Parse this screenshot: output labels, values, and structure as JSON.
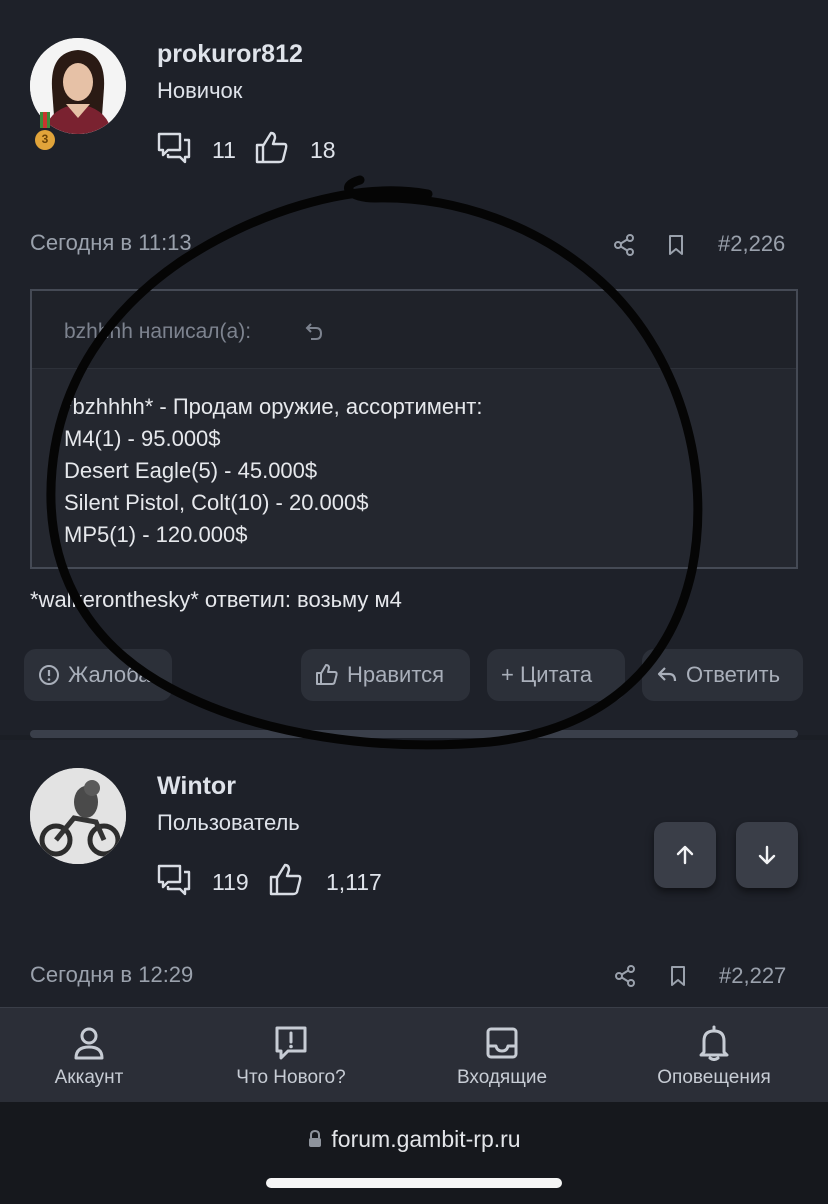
{
  "post1": {
    "username": "prokuror812",
    "role": "Новичок",
    "badge": "3",
    "messages": "11",
    "likes": "18",
    "date": "Сегодня в 11:13",
    "post_number": "#2,226",
    "quote": {
      "author": "bzhhhh написал(а):",
      "lines": [
        "*bzhhhh* - Продам оружие, ассортимент:",
        "M4(1) - 95.000$",
        "Desert Eagle(5) - 45.000$",
        "Silent Pistol, Colt(10) - 20.000$",
        "MP5(1) - 120.000$"
      ]
    },
    "reply": "*walkeronthesky* ответил: возьму м4",
    "actions": {
      "report": "Жалоба",
      "like": "Нравится",
      "quote": "+ Цитата",
      "reply": "Ответить"
    }
  },
  "post2": {
    "username": "Wintor",
    "role": "Пользователь",
    "messages": "119",
    "likes": "1,117",
    "date": "Сегодня в 12:29",
    "post_number": "#2,227"
  },
  "tabbar": {
    "items": [
      {
        "label": "Аккаунт",
        "icon": "user-icon"
      },
      {
        "label": "Что Нового?",
        "icon": "whats-new-icon"
      },
      {
        "label": "Входящие",
        "icon": "inbox-icon"
      },
      {
        "label": "Оповещения",
        "icon": "bell-icon"
      }
    ]
  },
  "browser": {
    "url": "forum.gambit-rp.ru"
  },
  "colors": {
    "background": "#1b1e25",
    "button": "#2c3039",
    "annotation_stroke": "#050505"
  }
}
